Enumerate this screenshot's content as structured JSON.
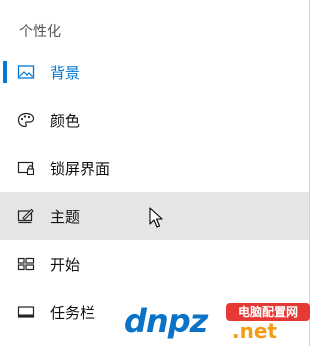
{
  "header": {
    "title": "个性化"
  },
  "nav": {
    "items": [
      {
        "label": "背景",
        "icon": "picture-icon",
        "selected": true
      },
      {
        "label": "颜色",
        "icon": "palette-icon"
      },
      {
        "label": "锁屏界面",
        "icon": "lock-screen-icon"
      },
      {
        "label": "主题",
        "icon": "theme-brush-icon",
        "hover": true
      },
      {
        "label": "开始",
        "icon": "start-layout-icon"
      },
      {
        "label": "任务栏",
        "icon": "taskbar-icon"
      }
    ]
  },
  "colors": {
    "accent": "#0078d7",
    "hover": "#e5e5e5"
  },
  "watermark": {
    "logo": "dnpz",
    "badge": "电脑配置网",
    "domain": ".net"
  }
}
